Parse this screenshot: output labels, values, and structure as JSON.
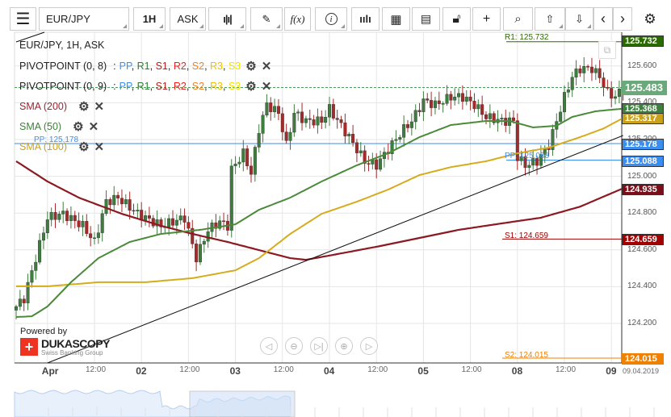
{
  "toolbar": {
    "symbol": "EUR/JPY",
    "timeframe": "1H",
    "price_side": "ASK",
    "function_label": "f(x)",
    "icons": [
      "menu-icon",
      "candlestick-icon",
      "pencil-icon",
      "function-icon",
      "info-icon",
      "bar-chart-icon",
      "calendar-icon",
      "news-icon",
      "lock-icon",
      "crosshair-icon",
      "zoom-search-icon",
      "upload-icon",
      "download-icon",
      "chevron-left-icon",
      "chevron-right-icon",
      "gear-icon"
    ]
  },
  "legend": {
    "title": "EUR/JPY, 1H, ASK",
    "pivot1": "PIVOTPOINT (0, 8)",
    "pivot2": "PIVOTPOINT (0, 9)",
    "pivot_levels": [
      {
        "name": "PP",
        "color": "#3a8ef0"
      },
      {
        "name": "R1",
        "color": "#2e7d32"
      },
      {
        "name": "S1",
        "color": "#b71c1c"
      },
      {
        "name": "R2",
        "color": "#f02020"
      },
      {
        "name": "S2",
        "color": "#f08020"
      },
      {
        "name": "R3",
        "color": "#f0c000"
      },
      {
        "name": "S3",
        "color": "#f0e000"
      }
    ],
    "sma200": "SMA (200)",
    "sma50": "SMA (50)",
    "sma100": "SMA (100)"
  },
  "levels": {
    "r1": {
      "label": "R1: 125.732",
      "value": 125.732,
      "tag": "125.732",
      "color": "#2a6b00"
    },
    "pp1": {
      "label": "PP: 125.178",
      "value": 125.178,
      "tag": "125.178",
      "color": "#3a8ef0"
    },
    "pp2": {
      "label": "PP: 125.088",
      "value": 125.088,
      "tag": "125.088",
      "color": "#3a8ef0"
    },
    "s1": {
      "label": "S1: 124.659",
      "value": 124.659,
      "tag": "124.659",
      "color": "#a00000"
    },
    "s2": {
      "label": "S2: 124.015",
      "value": 124.015,
      "tag": "124.015",
      "color": "#f08000"
    },
    "current": {
      "value": 125.483,
      "tag": "125.483",
      "color": "#6aaa7a"
    },
    "sma50_tag": {
      "value": 125.368,
      "tag": "125.368",
      "color": "#3f7f3f"
    },
    "sma100_tag": {
      "value": 125.317,
      "tag": "125.317",
      "color": "#c9a21a"
    },
    "sma200_tag": {
      "value": 124.935,
      "tag": "124.935",
      "color": "#7a0f1a"
    }
  },
  "y_axis": {
    "min": 124.0,
    "max": 125.8,
    "ticks": [
      "125.600",
      "125.400",
      "125.200",
      "125.000",
      "124.800",
      "124.600",
      "124.400",
      "124.200"
    ]
  },
  "x_axis": {
    "labels": [
      {
        "t": "Apr",
        "h": 8,
        "day": true
      },
      {
        "t": "12:00",
        "h": 20
      },
      {
        "t": "02",
        "h": 32,
        "day": true
      },
      {
        "t": "12:00",
        "h": 44
      },
      {
        "t": "03",
        "h": 56,
        "day": true
      },
      {
        "t": "12:00",
        "h": 68
      },
      {
        "t": "04",
        "h": 80,
        "day": true
      },
      {
        "t": "12:00",
        "h": 92
      },
      {
        "t": "05",
        "h": 104,
        "day": true
      },
      {
        "t": "12:00",
        "h": 116
      },
      {
        "t": "08",
        "h": 128,
        "day": true
      },
      {
        "t": "12:00",
        "h": 140
      },
      {
        "t": "09",
        "h": 152,
        "day": true
      }
    ],
    "current_date": "09.04.2019"
  },
  "chart_data": {
    "type": "candlestick",
    "bars": 156,
    "price_path": [
      [
        0,
        124.292
      ],
      [
        2,
        124.336
      ],
      [
        5,
        124.555
      ],
      [
        8,
        124.775
      ],
      [
        12,
        124.796
      ],
      [
        17,
        124.731
      ],
      [
        20,
        124.643
      ],
      [
        23,
        124.862
      ],
      [
        26,
        124.884
      ],
      [
        31,
        124.796
      ],
      [
        37,
        124.731
      ],
      [
        43,
        124.775
      ],
      [
        46,
        124.555
      ],
      [
        49,
        124.709
      ],
      [
        52,
        124.753
      ],
      [
        54,
        124.731
      ],
      [
        55,
        125.038
      ],
      [
        58,
        125.125
      ],
      [
        60,
        125.016
      ],
      [
        62,
        125.257
      ],
      [
        64,
        125.389
      ],
      [
        67,
        125.345
      ],
      [
        69,
        125.169
      ],
      [
        71,
        125.345
      ],
      [
        74,
        125.301
      ],
      [
        78,
        125.301
      ],
      [
        80,
        125.367
      ],
      [
        85,
        125.213
      ],
      [
        89,
        125.082
      ],
      [
        92,
        125.06
      ],
      [
        95,
        125.147
      ],
      [
        99,
        125.257
      ],
      [
        101,
        125.301
      ],
      [
        104,
        125.411
      ],
      [
        107,
        125.389
      ],
      [
        111,
        125.432
      ],
      [
        114,
        125.432
      ],
      [
        117,
        125.389
      ],
      [
        120,
        125.323
      ],
      [
        124,
        125.301
      ],
      [
        127,
        125.301
      ],
      [
        128,
        125.104
      ],
      [
        130,
        125.06
      ],
      [
        133,
        125.082
      ],
      [
        136,
        125.169
      ],
      [
        138,
        125.301
      ],
      [
        140,
        125.432
      ],
      [
        142,
        125.542
      ],
      [
        144,
        125.586
      ],
      [
        147,
        125.586
      ],
      [
        149,
        125.542
      ],
      [
        151,
        125.454
      ],
      [
        153,
        125.432
      ],
      [
        155,
        125.483
      ]
    ],
    "sma200": [
      [
        0,
        125.082
      ],
      [
        8,
        124.972
      ],
      [
        16,
        124.884
      ],
      [
        27,
        124.796
      ],
      [
        37,
        124.731
      ],
      [
        45,
        124.687
      ],
      [
        54,
        124.643
      ],
      [
        62,
        124.599
      ],
      [
        70,
        124.555
      ],
      [
        74,
        124.546
      ],
      [
        82,
        124.577
      ],
      [
        93,
        124.621
      ],
      [
        103,
        124.665
      ],
      [
        113,
        124.709
      ],
      [
        124,
        124.744
      ],
      [
        134,
        124.775
      ],
      [
        144,
        124.835
      ],
      [
        155,
        124.935
      ]
    ],
    "sma50": [
      [
        0,
        124.235
      ],
      [
        4,
        124.239
      ],
      [
        8,
        124.292
      ],
      [
        14,
        124.424
      ],
      [
        21,
        124.555
      ],
      [
        29,
        124.643
      ],
      [
        37,
        124.687
      ],
      [
        47,
        124.709
      ],
      [
        56,
        124.739
      ],
      [
        62,
        124.818
      ],
      [
        70,
        124.884
      ],
      [
        78,
        124.972
      ],
      [
        87,
        125.06
      ],
      [
        95,
        125.125
      ],
      [
        103,
        125.213
      ],
      [
        111,
        125.279
      ],
      [
        120,
        125.301
      ],
      [
        126,
        125.301
      ],
      [
        132,
        125.266
      ],
      [
        138,
        125.275
      ],
      [
        142,
        125.323
      ],
      [
        148,
        125.354
      ],
      [
        155,
        125.368
      ]
    ],
    "sma100": [
      [
        0,
        124.402
      ],
      [
        8,
        124.402
      ],
      [
        21,
        124.424
      ],
      [
        33,
        124.424
      ],
      [
        45,
        124.446
      ],
      [
        56,
        124.489
      ],
      [
        62,
        124.555
      ],
      [
        70,
        124.687
      ],
      [
        78,
        124.796
      ],
      [
        87,
        124.862
      ],
      [
        95,
        124.928
      ],
      [
        103,
        125.007
      ],
      [
        111,
        125.05
      ],
      [
        120,
        125.082
      ],
      [
        128,
        125.125
      ],
      [
        136,
        125.156
      ],
      [
        144,
        125.213
      ],
      [
        150,
        125.26
      ],
      [
        155,
        125.317
      ]
    ],
    "trendline": [
      [
        8,
        123.985
      ],
      [
        155,
        125.222
      ]
    ]
  },
  "branding": {
    "powered_by": "Powered by",
    "brand": "DUKASCOPY",
    "sub": "Swiss Banking Group"
  }
}
